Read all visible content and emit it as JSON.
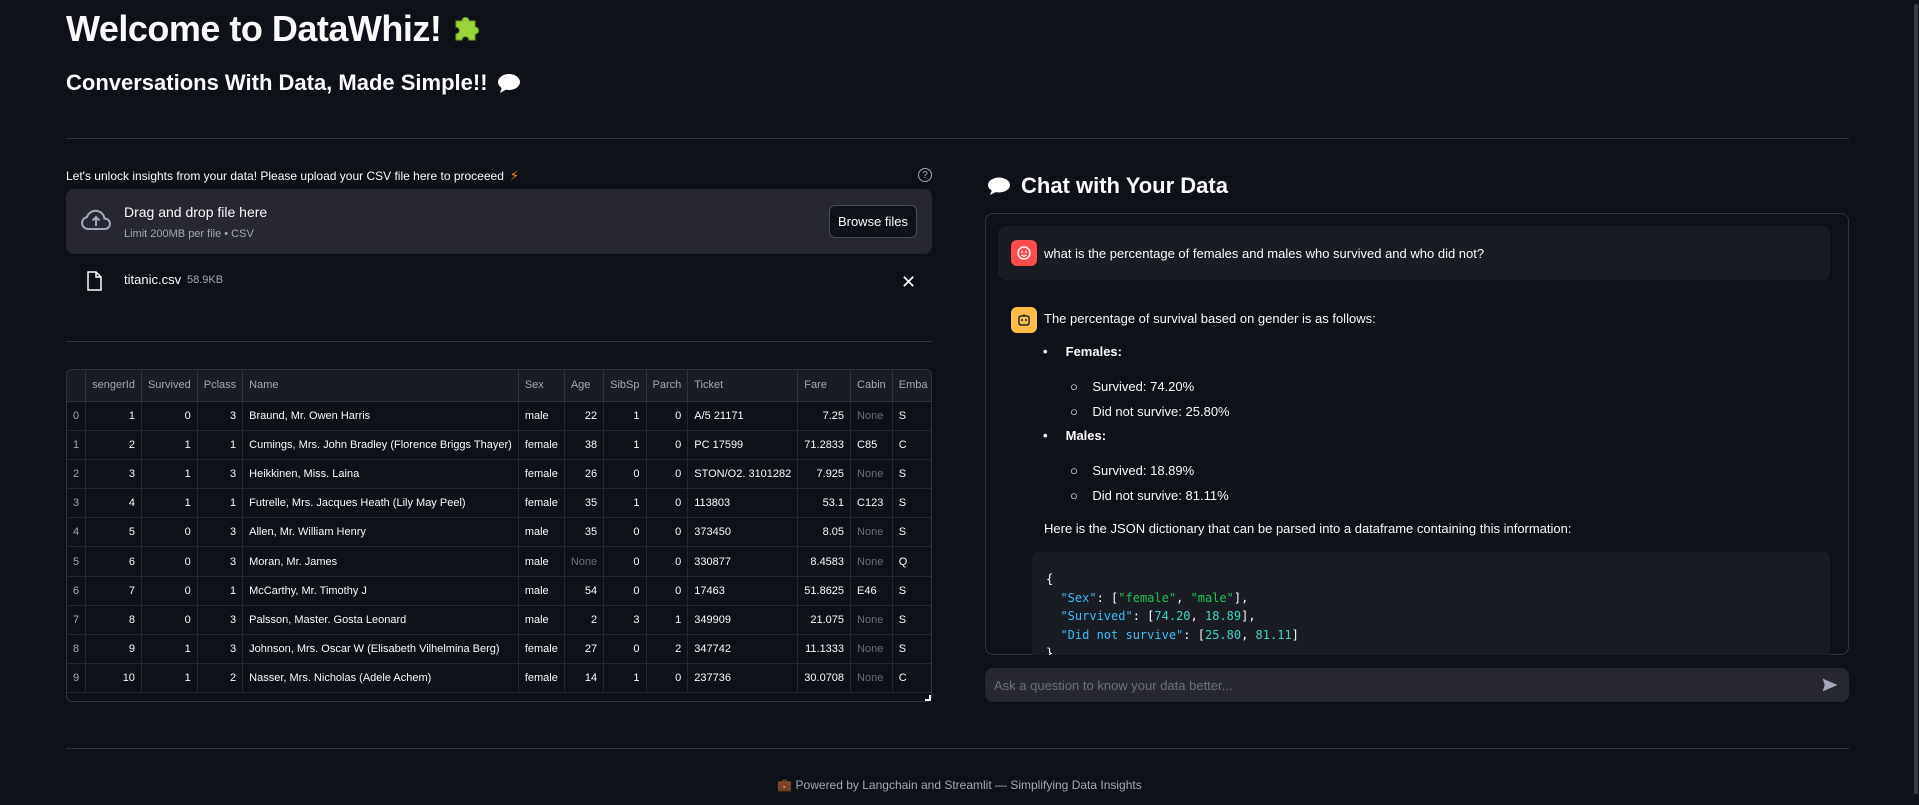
{
  "header": {
    "title": "Welcome to DataWhiz!",
    "subtitle": "Conversations With Data, Made Simple!!"
  },
  "upload": {
    "label": "Let's unlock insights from your data! Please upload your CSV file here to proceeed",
    "dropzone_title": "Drag and drop file here",
    "dropzone_subtitle": "Limit 200MB per file • CSV",
    "browse_label": "Browse files",
    "file_name": "titanic.csv",
    "file_size": "58.9KB"
  },
  "table": {
    "columns": [
      "",
      "sengerId",
      "Survived",
      "Pclass",
      "Name",
      "Sex",
      "Age",
      "SibSp",
      "Parch",
      "Ticket",
      "Fare",
      "Cabin",
      "Emba"
    ],
    "rows": [
      [
        "0",
        "1",
        "0",
        "3",
        "Braund, Mr. Owen Harris",
        "male",
        "22",
        "1",
        "0",
        "A/5 21171",
        "7.25",
        "None",
        "S"
      ],
      [
        "1",
        "2",
        "1",
        "1",
        "Cumings, Mrs. John Bradley (Florence Briggs Thayer)",
        "female",
        "38",
        "1",
        "0",
        "PC 17599",
        "71.2833",
        "C85",
        "C"
      ],
      [
        "2",
        "3",
        "1",
        "3",
        "Heikkinen, Miss. Laina",
        "female",
        "26",
        "0",
        "0",
        "STON/O2. 3101282",
        "7.925",
        "None",
        "S"
      ],
      [
        "3",
        "4",
        "1",
        "1",
        "Futrelle, Mrs. Jacques Heath (Lily May Peel)",
        "female",
        "35",
        "1",
        "0",
        "113803",
        "53.1",
        "C123",
        "S"
      ],
      [
        "4",
        "5",
        "0",
        "3",
        "Allen, Mr. William Henry",
        "male",
        "35",
        "0",
        "0",
        "373450",
        "8.05",
        "None",
        "S"
      ],
      [
        "5",
        "6",
        "0",
        "3",
        "Moran, Mr. James",
        "male",
        "None",
        "0",
        "0",
        "330877",
        "8.4583",
        "None",
        "Q"
      ],
      [
        "6",
        "7",
        "0",
        "1",
        "McCarthy, Mr. Timothy J",
        "male",
        "54",
        "0",
        "0",
        "17463",
        "51.8625",
        "E46",
        "S"
      ],
      [
        "7",
        "8",
        "0",
        "3",
        "Palsson, Master. Gosta Leonard",
        "male",
        "2",
        "3",
        "1",
        "349909",
        "21.075",
        "None",
        "S"
      ],
      [
        "8",
        "9",
        "1",
        "3",
        "Johnson, Mrs. Oscar W (Elisabeth Vilhelmina Berg)",
        "female",
        "27",
        "0",
        "2",
        "347742",
        "11.1333",
        "None",
        "S"
      ],
      [
        "9",
        "10",
        "1",
        "2",
        "Nasser, Mrs. Nicholas (Adele Achem)",
        "female",
        "14",
        "1",
        "0",
        "237736",
        "30.0708",
        "None",
        "C"
      ]
    ]
  },
  "chat": {
    "title": "Chat with Your Data",
    "user_question": "what is the percentage of females and males who survived and who did not?",
    "bot_intro": "The percentage of survival based on gender is as follows:",
    "groups": [
      {
        "label": "Females:",
        "items": [
          "Survived: 74.20%",
          "Did not survive: 25.80%"
        ]
      },
      {
        "label": "Males:",
        "items": [
          "Survived: 18.89%",
          "Did not survive: 81.11%"
        ]
      }
    ],
    "json_intro": "Here is the JSON dictionary that can be parsed into a dataframe containing this information:",
    "code": {
      "sex_key": "\"Sex\"",
      "sex_vals": [
        "\"female\"",
        "\"male\""
      ],
      "survived_key": "\"Survived\"",
      "survived_vals": [
        "74.20",
        "18.89"
      ],
      "dns_key": "\"Did not survive\"",
      "dns_vals": [
        "25.80",
        "81.11"
      ]
    },
    "input_placeholder": "Ask a question to know your data better..."
  },
  "footer": {
    "text": "Powered by Langchain and Streamlit — Simplifying Data Insights"
  }
}
